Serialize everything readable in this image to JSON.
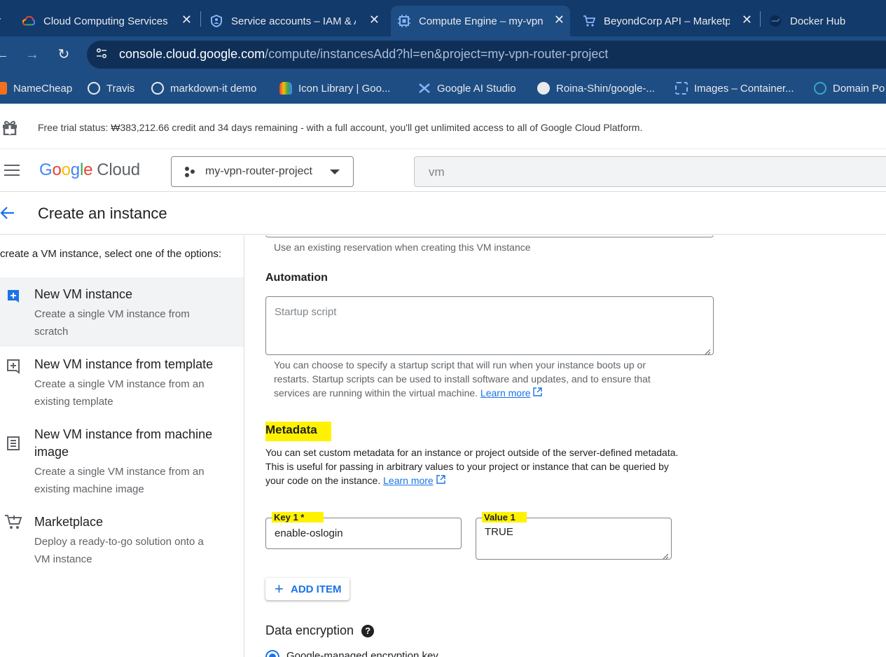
{
  "browser": {
    "tabs": [
      {
        "title": "Cloud Computing Services"
      },
      {
        "title": "Service accounts – IAM & Admin"
      },
      {
        "title": "Compute Engine – my-vpn-router-project"
      },
      {
        "title": "BeyondCorp API – Marketplace"
      },
      {
        "title": "Docker Hub"
      }
    ],
    "url_host": "console.cloud.google.com",
    "url_path": "/compute/instancesAdd?hl=en&project=my-vpn-router-project",
    "bookmarks": [
      {
        "label": "NameCheap",
        "color": "#f37021"
      },
      {
        "label": "Travis",
        "color": "#e8eaed"
      },
      {
        "label": "markdown-it demo",
        "color": "#e8eaed"
      },
      {
        "label": "Icon Library | Goo...",
        "color": "#fbbc04"
      },
      {
        "label": "Google AI Studio",
        "color": "#4285f4"
      },
      {
        "label": "Roina-Shin/google-...",
        "color": "#e8eaed"
      },
      {
        "label": "Images – Container...",
        "color": "#8ab4f8"
      },
      {
        "label": "Domain Po",
        "color": "#34a8c7"
      }
    ]
  },
  "trial": {
    "text": "Free trial status: ₩383,212.66 credit and 34 days remaining - with a full account, you'll get unlimited access to all of Google Cloud Platform."
  },
  "header": {
    "logo_google": "Google",
    "logo_cloud": "Cloud",
    "project": "my-vpn-router-project",
    "search_value": "vm"
  },
  "page": {
    "title": "Create an instance"
  },
  "left": {
    "intro": "create a VM instance, select one of the options:",
    "options": [
      {
        "title": "New VM instance",
        "desc1": "Create a single VM instance from",
        "desc2": "scratch"
      },
      {
        "title": "New VM instance from template",
        "desc1": "Create a single VM instance from an",
        "desc2": "existing template"
      },
      {
        "title": "New VM instance from machine",
        "title2": "image",
        "desc1": "Create a single VM instance from an",
        "desc2": "existing machine image"
      },
      {
        "title": "Marketplace",
        "desc1": "Deploy a ready-to-go solution onto a",
        "desc2": "VM instance"
      }
    ]
  },
  "form": {
    "reservation_hint": "Use an existing reservation when creating this VM instance",
    "automation": {
      "heading": "Automation",
      "placeholder": "Startup script",
      "hint1": "You can choose to specify a startup script that will run when your instance boots up or",
      "hint2": "restarts. Startup scripts can be used to install software and updates, and to ensure that",
      "hint3": "services are running within the virtual machine.",
      "learn_more": "Learn more"
    },
    "metadata": {
      "heading": "Metadata",
      "desc1": "You can set custom metadata for an instance or project outside of the server-defined metadata.",
      "desc2": "This is useful for passing in arbitrary values to your project or instance that can be queried by",
      "desc3": "your code on the instance.",
      "learn_more": "Learn more",
      "key_label": "Key 1 *",
      "key_value": "enable-oslogin",
      "value_label": "Value 1",
      "value_value": "TRUE",
      "add_item": "ADD ITEM"
    },
    "encryption": {
      "heading": "Data encryption",
      "option1": "Google-managed encryption key"
    }
  },
  "colors": {
    "accent": "#1a73e8",
    "highlight": "#fff200",
    "chrome_dark": "#123a6b",
    "chrome": "#1e4d84"
  }
}
